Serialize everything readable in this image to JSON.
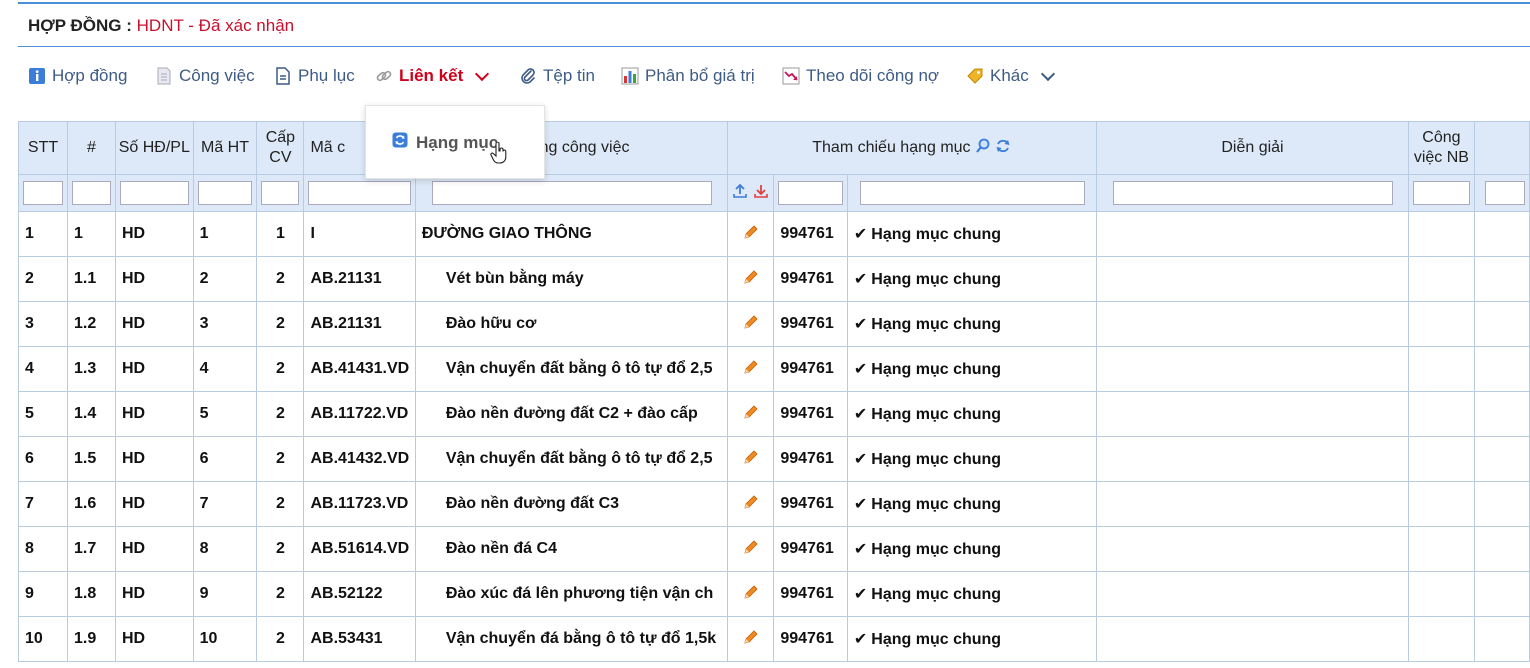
{
  "header": {
    "label": "HỢP ĐỒNG :",
    "status": "HDNT - Đã xác nhận"
  },
  "tabs": [
    {
      "label": "Hợp đồng",
      "icon": "info-icon"
    },
    {
      "label": "Công việc",
      "icon": "document-icon"
    },
    {
      "label": "Phụ lục",
      "icon": "file-text-icon"
    },
    {
      "label": "Liên kết",
      "icon": "link-icon"
    },
    {
      "label": "Tệp tin",
      "icon": "paperclip-icon"
    },
    {
      "label": "Phân bổ giá trị",
      "icon": "bar-chart-icon"
    },
    {
      "label": "Theo dõi công nợ",
      "icon": "trend-down-icon"
    },
    {
      "label": "Khác",
      "icon": "tag-icon"
    }
  ],
  "dropdown": {
    "item": "Hạng mục"
  },
  "columns": {
    "stt": "STT",
    "num": "#",
    "so_hd": "Số HĐ/PL",
    "ma_ht": "Mã HT",
    "cap_cv_1": "Cấp",
    "cap_cv_2": "CV",
    "ma_cv": "Mã c",
    "noi_dung": "dung công việc",
    "tham_chieu": "Tham chiếu hạng mục",
    "dien_giai": "Diễn giải",
    "cong_viec_nb_1": "Công",
    "cong_viec_nb_2": "việc NB"
  },
  "rows": [
    {
      "stt": "1",
      "num": "1",
      "so_hd": "HD",
      "ma_ht": "1",
      "cap": "1",
      "ma_cv": "I",
      "noi_dung": "ĐƯỜNG GIAO THÔNG",
      "ref": "994761",
      "hang_muc": "Hạng mục chung"
    },
    {
      "stt": "2",
      "num": "1.1",
      "so_hd": "HD",
      "ma_ht": "2",
      "cap": "2",
      "ma_cv": "AB.21131",
      "noi_dung": "Vét bùn bằng máy",
      "ref": "994761",
      "hang_muc": "Hạng mục chung"
    },
    {
      "stt": "3",
      "num": "1.2",
      "so_hd": "HD",
      "ma_ht": "3",
      "cap": "2",
      "ma_cv": "AB.21131",
      "noi_dung": "Đào hữu cơ",
      "ref": "994761",
      "hang_muc": "Hạng mục chung"
    },
    {
      "stt": "4",
      "num": "1.3",
      "so_hd": "HD",
      "ma_ht": "4",
      "cap": "2",
      "ma_cv": "AB.41431.VD",
      "noi_dung": "Vận chuyển đất bằng ô tô tự đổ 2,5",
      "ref": "994761",
      "hang_muc": "Hạng mục chung"
    },
    {
      "stt": "5",
      "num": "1.4",
      "so_hd": "HD",
      "ma_ht": "5",
      "cap": "2",
      "ma_cv": "AB.11722.VD",
      "noi_dung": "Đào nền đường đất C2 + đào cấp",
      "ref": "994761",
      "hang_muc": "Hạng mục chung"
    },
    {
      "stt": "6",
      "num": "1.5",
      "so_hd": "HD",
      "ma_ht": "6",
      "cap": "2",
      "ma_cv": "AB.41432.VD",
      "noi_dung": "Vận chuyển đất bằng ô tô tự đổ 2,5",
      "ref": "994761",
      "hang_muc": "Hạng mục chung"
    },
    {
      "stt": "7",
      "num": "1.6",
      "so_hd": "HD",
      "ma_ht": "7",
      "cap": "2",
      "ma_cv": "AB.11723.VD",
      "noi_dung": "Đào nền đường đất C3",
      "ref": "994761",
      "hang_muc": "Hạng mục chung"
    },
    {
      "stt": "8",
      "num": "1.7",
      "so_hd": "HD",
      "ma_ht": "8",
      "cap": "2",
      "ma_cv": "AB.51614.VD",
      "noi_dung": "Đào nền đá C4",
      "ref": "994761",
      "hang_muc": "Hạng mục chung"
    },
    {
      "stt": "9",
      "num": "1.8",
      "so_hd": "HD",
      "ma_ht": "9",
      "cap": "2",
      "ma_cv": "AB.52122",
      "noi_dung": "Đào xúc đá lên phương tiện vận ch",
      "ref": "994761",
      "hang_muc": "Hạng mục chung"
    },
    {
      "stt": "10",
      "num": "1.9",
      "so_hd": "HD",
      "ma_ht": "10",
      "cap": "2",
      "ma_cv": "AB.53431",
      "noi_dung": "Vận chuyển đá bằng ô tô tự đổ 1,5k",
      "ref": "994761",
      "hang_muc": "Hạng mục chung"
    }
  ]
}
